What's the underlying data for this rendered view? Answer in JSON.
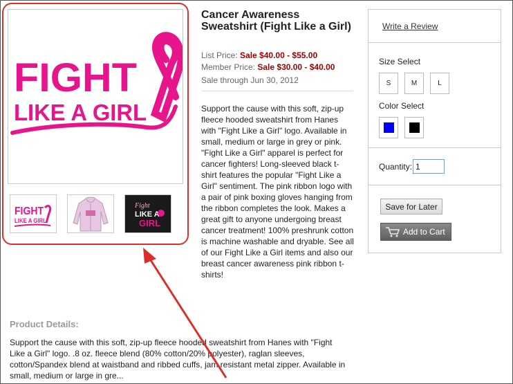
{
  "product": {
    "title": "Cancer Awareness Sweatshirt (Fight Like a Girl)",
    "list_price_label": "List Price:",
    "list_price_value": "Sale $40.00 - $55.00",
    "member_price_label": "Member Price:",
    "member_price_value": "Sale $30.00 - $40.00",
    "sale_through": "Sale through Jun 30, 2012",
    "description": "Support the cause with this soft, zip-up fleece hooded sweatshirt from Hanes with \"Fight Like a Girl\" logo. Available in small, medium or large in grey or pink. \"Fight Like a Girl\" apparel is perfect for cancer fighters!  Long-sleeved black t-shirt features the popular \"Fight Like a Girl\" sentiment.  The pink ribbon logo with a pair of pink boxing gloves hanging from the ribbon completes the look.  Makes a great gift to anyone undergoing breast cancer treatment! 100% preshrunk cotton is machine washable and dryable.  See all of our Fight Like a Girl items and also our breast cancer awareness pink ribbon t-shirts!"
  },
  "main_image": {
    "line1": "FIGHT",
    "line2": "LIKE A GIRL",
    "accent_color": "#e6158c"
  },
  "thumbnails": {
    "thumb1_line1": "FIGHT",
    "thumb1_line2": "LIKE A GIRL",
    "thumb3_line1": "Fight",
    "thumb3_line2": "LIKE A",
    "thumb3_line3": "GIRL"
  },
  "sidebar": {
    "write_review": "Write a Review",
    "size_label": "Size Select",
    "sizes": [
      "S",
      "M",
      "L"
    ],
    "color_label": "Color Select",
    "colors": [
      "#0000ff",
      "#000000"
    ],
    "quantity_label": "Quantity:",
    "quantity_value": "1",
    "save_for_later": "Save for Later",
    "add_to_cart": "Add to Cart"
  },
  "details": {
    "heading": "Product Details:",
    "text": "Support the cause with this soft, zip-up fleece hooded sweatshirt from Hanes with \"Fight Like a Girl\" logo. .8 oz. fleece blend (80% cotton/20% polyester), raglan sleeves, cotton/Spandex blend at waistband and ribbed cuffs, jam resistant metal zipper.  Available in small, medium or large in gre..."
  },
  "annotation": {
    "highlight_color": "#d9302a"
  }
}
